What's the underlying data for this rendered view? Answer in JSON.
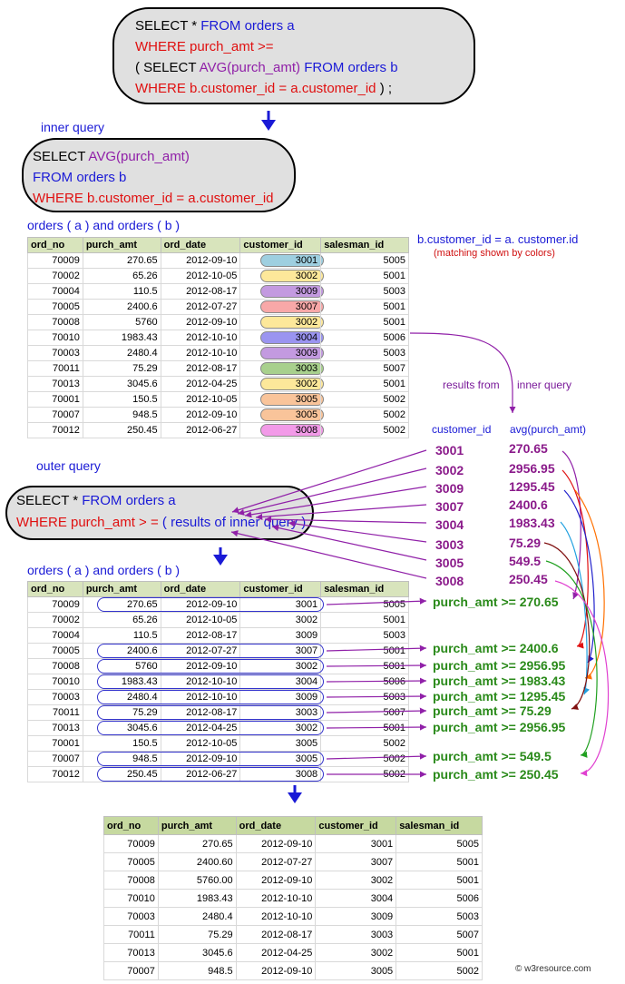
{
  "top_query": {
    "l1_a": "SELECT * ",
    "l1_b": "FROM orders a",
    "l2": "WHERE purch_amt >=",
    "l3_a": "( SELECT ",
    "l3_b": "AVG(purch_amt) ",
    "l3_c": "FROM orders b",
    "l4_a": "WHERE b.customer_id = a.customer_id",
    "l4_b": ") ;"
  },
  "inner_label": "inner query",
  "inner_query": {
    "l1_a": "SELECT ",
    "l1_b": "AVG(purch_amt)",
    "l2": "FROM orders b",
    "l3": "WHERE b.customer_id = a.customer_id"
  },
  "table1_title": "orders ( a ) and orders ( b )",
  "match_title": "b.customer_id = a. customer.id",
  "match_note": "(matching shown by colors)",
  "headers": [
    "ord_no",
    "purch_amt",
    "ord_date",
    "customer_id",
    "salesman_id"
  ],
  "rows": [
    [
      "70009",
      "270.65",
      "2012-09-10",
      "3001",
      "5005"
    ],
    [
      "70002",
      "65.26",
      "2012-10-05",
      "3002",
      "5001"
    ],
    [
      "70004",
      "110.5",
      "2012-08-17",
      "3009",
      "5003"
    ],
    [
      "70005",
      "2400.6",
      "2012-07-27",
      "3007",
      "5001"
    ],
    [
      "70008",
      "5760",
      "2012-09-10",
      "3002",
      "5001"
    ],
    [
      "70010",
      "1983.43",
      "2012-10-10",
      "3004",
      "5006"
    ],
    [
      "70003",
      "2480.4",
      "2012-10-10",
      "3009",
      "5003"
    ],
    [
      "70011",
      "75.29",
      "2012-08-17",
      "3003",
      "5007"
    ],
    [
      "70013",
      "3045.6",
      "2012-04-25",
      "3002",
      "5001"
    ],
    [
      "70001",
      "150.5",
      "2012-10-05",
      "3005",
      "5002"
    ],
    [
      "70007",
      "948.5",
      "2012-09-10",
      "3005",
      "5002"
    ],
    [
      "70012",
      "250.45",
      "2012-06-27",
      "3008",
      "5002"
    ]
  ],
  "customer_colors": {
    "3001": "#9ecfe0",
    "3002": "#fde89a",
    "3009": "#c39ae0",
    "3007": "#f8a8a8",
    "3004": "#9a94f0",
    "3003": "#a8d08d",
    "3005": "#f9c49a",
    "3008": "#f29ae8"
  },
  "results_label_a": "results from",
  "results_label_b": "inner query",
  "col_customer": "customer_id",
  "col_avg": "avg(purch_amt)",
  "avg_results": [
    {
      "id": "3001",
      "avg": "270.65"
    },
    {
      "id": "3002",
      "avg": "2956.95"
    },
    {
      "id": "3009",
      "avg": "1295.45"
    },
    {
      "id": "3007",
      "avg": "2400.6"
    },
    {
      "id": "3004",
      "avg": "1983.43"
    },
    {
      "id": "3003",
      "avg": "75.29"
    },
    {
      "id": "3005",
      "avg": "549.5"
    },
    {
      "id": "3008",
      "avg": "250.45"
    }
  ],
  "outer_label": "outer query",
  "outer_query": {
    "l1_a": "SELECT * ",
    "l1_b": "FROM orders a",
    "l2_a": "WHERE purch_amt > = ",
    "l2_b": "( results of inner query )"
  },
  "table2_title": "orders ( a ) and orders ( b )",
  "conditions": [
    "purch_amt >= 270.65",
    "purch_amt >= 2400.6",
    "purch_amt >= 2956.95",
    "purch_amt >= 1983.43",
    "purch_amt >= 1295.45",
    "purch_amt >= 75.29",
    "purch_amt >= 2956.95",
    "purch_amt >= 549.5",
    "purch_amt >= 250.45"
  ],
  "final_rows": [
    [
      "70009",
      "270.65",
      "2012-09-10",
      "3001",
      "5005"
    ],
    [
      "70005",
      "2400.60",
      "2012-07-27",
      "3007",
      "5001"
    ],
    [
      "70008",
      "5760.00",
      "2012-09-10",
      "3002",
      "5001"
    ],
    [
      "70010",
      "1983.43",
      "2012-10-10",
      "3004",
      "5006"
    ],
    [
      "70003",
      "2480.4",
      "2012-10-10",
      "3009",
      "5003"
    ],
    [
      "70011",
      "75.29",
      "2012-08-17",
      "3003",
      "5007"
    ],
    [
      "70013",
      "3045.6",
      "2012-04-25",
      "3002",
      "5001"
    ],
    [
      "70007",
      "948.5",
      "2012-09-10",
      "3005",
      "5002"
    ]
  ],
  "watermark": "© w3resource.com"
}
